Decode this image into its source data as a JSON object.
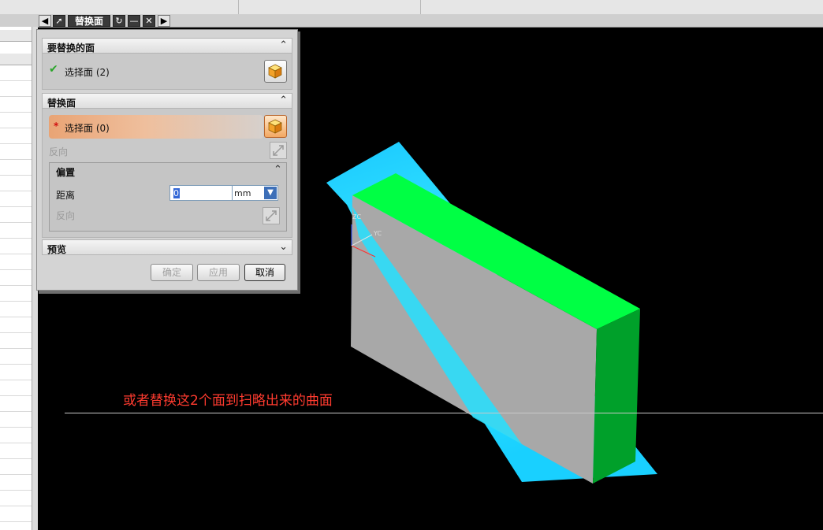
{
  "dialog": {
    "title": "替换面",
    "title_buttons": [
      "back-icon",
      "pin-icon",
      "reset-icon",
      "minimize-icon",
      "close-icon",
      "forward-icon"
    ],
    "groups": {
      "faces_to_replace": {
        "header": "要替换的面",
        "select_label": "选择面 (2)",
        "status_icon": "checkmark-icon"
      },
      "replacement_face": {
        "header": "替换面",
        "select_label": "选择面 (0)",
        "required_mark": "*",
        "reverse_label": "反向"
      },
      "offset": {
        "header": "偏置",
        "distance_label": "距离",
        "distance_value": "0",
        "unit": "mm",
        "reverse_label": "反向"
      },
      "preview": {
        "header": "预览"
      }
    },
    "buttons": {
      "ok": "确定",
      "apply": "应用",
      "cancel": "取消"
    }
  },
  "viewport": {
    "annotation": "或者替换这2个面到扫略出来的曲面",
    "axis_labels": {
      "zc": "ZC",
      "yc": "YC"
    },
    "colors": {
      "top_face": "#00ff44",
      "side_face": "#00a02a",
      "front_face": "#a8a8a8",
      "sweep_surface": "#19d6ff",
      "annotation": "#ff3b2f",
      "background": "#000000"
    }
  }
}
